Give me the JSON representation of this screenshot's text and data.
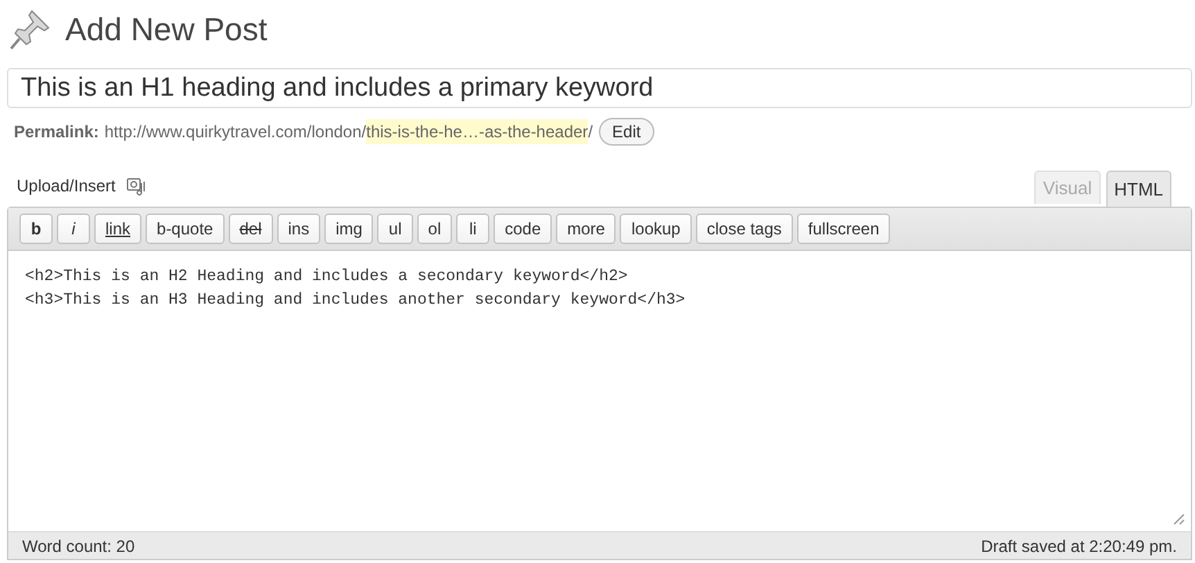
{
  "page_title": "Add New Post",
  "post_title": {
    "value": "This is an H1 heading and includes a primary keyword"
  },
  "permalink": {
    "label": "Permalink:",
    "base": "http://www.quirkytravel.com/london/",
    "slug": "this-is-the-he…-as-the-header",
    "trail": "/",
    "button": "Edit"
  },
  "upload_insert": {
    "label": "Upload/Insert"
  },
  "tabs": [
    {
      "label": "Visual",
      "selected": false
    },
    {
      "label": "HTML",
      "selected": true
    }
  ],
  "quicktags": [
    {
      "label": "b",
      "kind": "bold"
    },
    {
      "label": "i",
      "kind": "italic"
    },
    {
      "label": "link",
      "kind": "underline"
    },
    {
      "label": "b-quote",
      "kind": "plain"
    },
    {
      "label": "del",
      "kind": "strike"
    },
    {
      "label": "ins",
      "kind": "plain"
    },
    {
      "label": "img",
      "kind": "plain"
    },
    {
      "label": "ul",
      "kind": "plain"
    },
    {
      "label": "ol",
      "kind": "plain"
    },
    {
      "label": "li",
      "kind": "plain"
    },
    {
      "label": "code",
      "kind": "plain"
    },
    {
      "label": "more",
      "kind": "plain"
    },
    {
      "label": "lookup",
      "kind": "plain"
    },
    {
      "label": "close tags",
      "kind": "plain"
    },
    {
      "label": "fullscreen",
      "kind": "plain"
    }
  ],
  "editor": {
    "lines": [
      "<h2>This is an H2 Heading and includes a secondary keyword</h2>",
      "<h3>This is an H3 Heading and includes another secondary keyword</h3>"
    ]
  },
  "status_bar": {
    "word_count": "Word count: 20",
    "draft_saved": "Draft saved at 2:20:49 pm."
  }
}
